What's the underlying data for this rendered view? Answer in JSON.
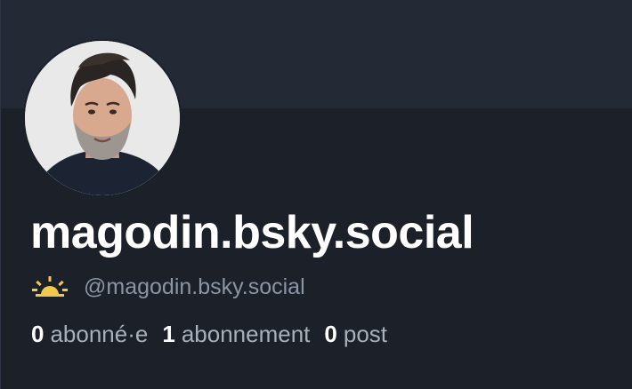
{
  "profile": {
    "display_name": "magodin.bsky.social",
    "handle": "@magodin.bsky.social",
    "status_icon": "sunrise-icon",
    "avatar_icon": "profile-photo"
  },
  "stats": {
    "followers_count": "0",
    "followers_label": "abonné·e",
    "following_count": "1",
    "following_label": "abonnement",
    "posts_count": "0",
    "posts_label": "post"
  },
  "colors": {
    "background": "#1b2029",
    "banner": "#232a36",
    "text_primary": "#ffffff",
    "text_secondary": "#8c95a4",
    "sun_accent": "#f2c94c"
  }
}
